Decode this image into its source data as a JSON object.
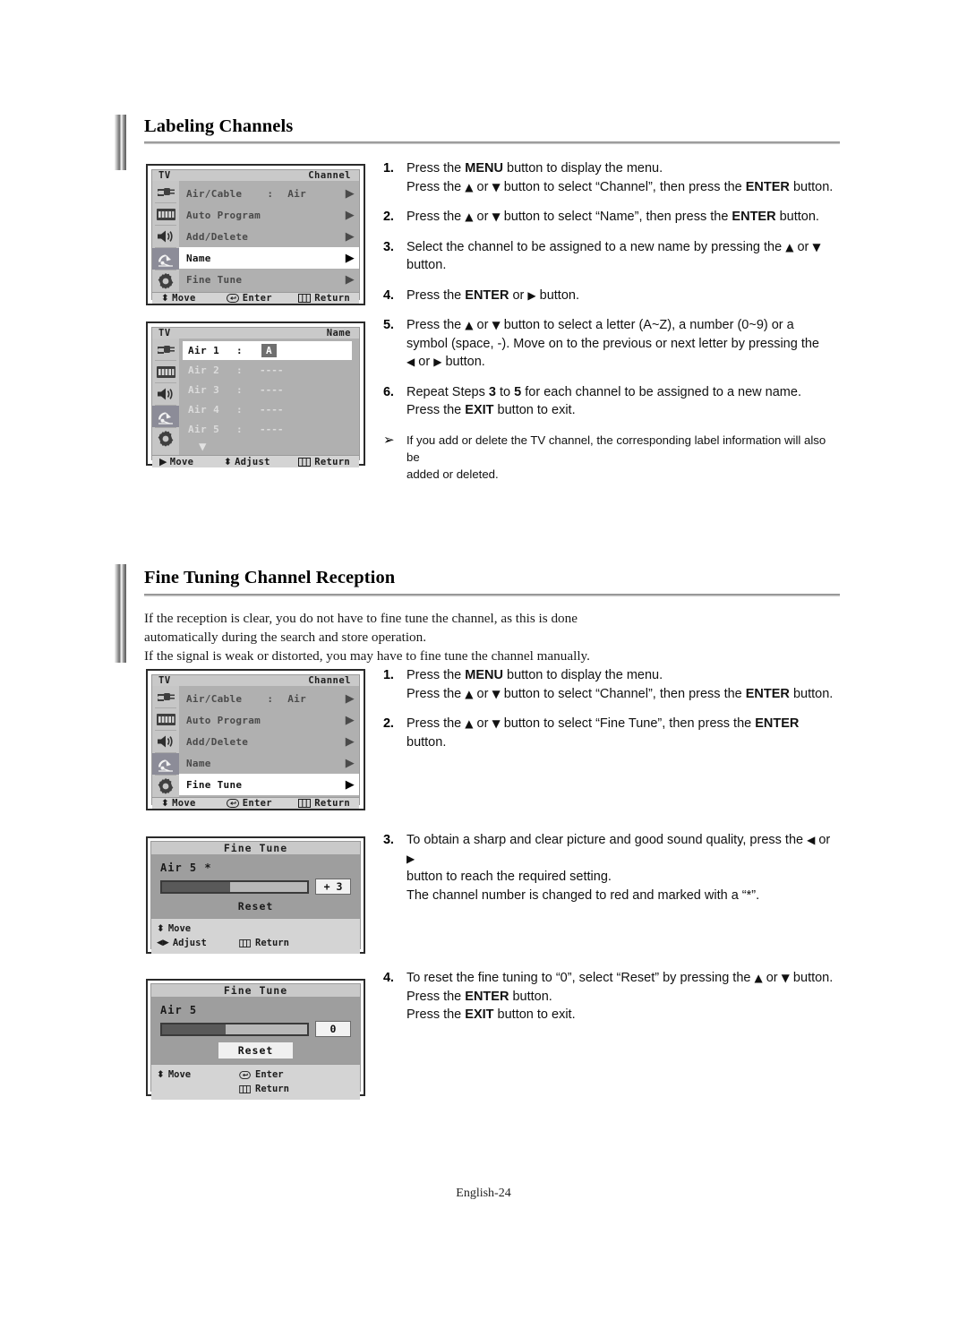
{
  "document": {
    "footer_page": "English-24"
  },
  "sections": [
    {
      "title": "Labeling Channels",
      "steps": [
        {
          "num": "1.",
          "lines": [
            {
              "parts": [
                {
                  "t": "Press the "
                },
                {
                  "t": "MENU",
                  "b": true
                },
                {
                  "t": " button to display the menu."
                }
              ]
            },
            {
              "parts": [
                {
                  "t": "Press the "
                },
                {
                  "t": "▲",
                  "icon": true
                },
                {
                  "t": " or "
                },
                {
                  "t": "▼",
                  "icon": true
                },
                {
                  "t": " button to select “Channel”, then press the "
                },
                {
                  "t": "ENTER",
                  "b": true
                },
                {
                  "t": " button."
                }
              ]
            }
          ]
        },
        {
          "num": "2.",
          "lines": [
            {
              "parts": [
                {
                  "t": "Press the "
                },
                {
                  "t": "▲",
                  "icon": true
                },
                {
                  "t": " or "
                },
                {
                  "t": "▼",
                  "icon": true
                },
                {
                  "t": " button to select “Name”, then press the "
                },
                {
                  "t": "ENTER",
                  "b": true
                },
                {
                  "t": " button."
                }
              ]
            }
          ]
        },
        {
          "num": "3.",
          "lines": [
            {
              "parts": [
                {
                  "t": "Select the channel to be assigned to a new name by pressing the "
                },
                {
                  "t": "▲",
                  "icon": true
                },
                {
                  "t": " or "
                },
                {
                  "t": "▼",
                  "icon": true
                }
              ]
            },
            {
              "parts": [
                {
                  "t": "button."
                }
              ]
            }
          ]
        },
        {
          "num": "4.",
          "lines": [
            {
              "parts": [
                {
                  "t": "Press the "
                },
                {
                  "t": "ENTER",
                  "b": true
                },
                {
                  "t": " or "
                },
                {
                  "t": "▶",
                  "icon": true
                },
                {
                  "t": " button."
                }
              ]
            }
          ]
        },
        {
          "num": "5.",
          "lines": [
            {
              "parts": [
                {
                  "t": "Press the "
                },
                {
                  "t": "▲",
                  "icon": true
                },
                {
                  "t": " or "
                },
                {
                  "t": "▼",
                  "icon": true
                },
                {
                  "t": " button to select a letter (A~Z), a number (0~9) or a"
                }
              ]
            },
            {
              "parts": [
                {
                  "t": "symbol (space, -). Move on to the previous or next letter by pressing the"
                }
              ]
            },
            {
              "parts": [
                {
                  "t": "◀",
                  "icon": true
                },
                {
                  "t": " or "
                },
                {
                  "t": "▶",
                  "icon": true
                },
                {
                  "t": " button."
                }
              ]
            }
          ]
        },
        {
          "num": "6.",
          "lines": [
            {
              "parts": [
                {
                  "t": "Repeat Steps "
                },
                {
                  "t": "3",
                  "b": true
                },
                {
                  "t": " to "
                },
                {
                  "t": "5",
                  "b": true
                },
                {
                  "t": " for each channel to be assigned to a new name."
                }
              ]
            },
            {
              "parts": [
                {
                  "t": "Press the "
                },
                {
                  "t": "EXIT",
                  "b": true
                },
                {
                  "t": " button to exit."
                }
              ]
            }
          ]
        }
      ],
      "note": {
        "mark": "➢",
        "lines": [
          "If you add or delete the TV channel, the corresponding label information will also be",
          "added or deleted."
        ]
      }
    },
    {
      "title": "Fine Tuning Channel Reception",
      "intro": [
        "If the reception is clear, you do not have to fine tune the channel, as this is done",
        "automatically during the search and store operation.",
        "If the signal is weak or distorted, you may have to fine tune the channel manually."
      ],
      "steps_top": [
        {
          "num": "1.",
          "lines": [
            {
              "parts": [
                {
                  "t": "Press the "
                },
                {
                  "t": "MENU",
                  "b": true
                },
                {
                  "t": " button to display the menu."
                }
              ]
            },
            {
              "parts": [
                {
                  "t": "Press the "
                },
                {
                  "t": "▲",
                  "icon": true
                },
                {
                  "t": " or "
                },
                {
                  "t": "▼",
                  "icon": true
                },
                {
                  "t": " button to select “Channel”, then press the "
                },
                {
                  "t": "ENTER",
                  "b": true
                },
                {
                  "t": " button."
                }
              ]
            }
          ]
        },
        {
          "num": "2.",
          "lines": [
            {
              "parts": [
                {
                  "t": "Press the "
                },
                {
                  "t": "▲",
                  "icon": true
                },
                {
                  "t": " or "
                },
                {
                  "t": "▼",
                  "icon": true
                },
                {
                  "t": " button to select “Fine Tune”, then press the "
                },
                {
                  "t": "ENTER",
                  "b": true
                }
              ]
            },
            {
              "parts": [
                {
                  "t": "button."
                }
              ]
            }
          ]
        }
      ],
      "steps_mid": [
        {
          "num": "3.",
          "lines": [
            {
              "parts": [
                {
                  "t": "To obtain a sharp and clear picture and good sound quality, press the "
                },
                {
                  "t": "◀",
                  "icon": true
                },
                {
                  "t": " or "
                },
                {
                  "t": "▶",
                  "icon": true
                }
              ]
            },
            {
              "parts": [
                {
                  "t": "button to reach the required setting."
                }
              ]
            },
            {
              "parts": [
                {
                  "t": "The channel number is changed to red and marked with a “*”."
                }
              ]
            }
          ]
        }
      ],
      "steps_bottom": [
        {
          "num": "4.",
          "lines": [
            {
              "parts": [
                {
                  "t": "To reset the fine tuning to “0”, select “Reset” by pressing the "
                },
                {
                  "t": "▲",
                  "icon": true
                },
                {
                  "t": " or "
                },
                {
                  "t": "▼",
                  "icon": true
                },
                {
                  "t": " button."
                }
              ]
            },
            {
              "parts": [
                {
                  "t": "Press the "
                },
                {
                  "t": "ENTER",
                  "b": true
                },
                {
                  "t": " button."
                }
              ]
            },
            {
              "parts": [
                {
                  "t": "Press the "
                },
                {
                  "t": "EXIT",
                  "b": true
                },
                {
                  "t": " button to exit."
                }
              ]
            }
          ]
        }
      ]
    }
  ],
  "osd_channel_name": {
    "device_label": "TV",
    "menu_title": "Channel",
    "rail_icons": [
      "input-icon",
      "picture-icon",
      "sound-icon",
      "channel-dish-icon",
      "setup-gear-icon"
    ],
    "selected_rail_index": 3,
    "rows": [
      {
        "label": "Air/Cable",
        "colon": ":",
        "value": "Air",
        "arrow": "▶",
        "highlighted": false
      },
      {
        "label": "Auto Program",
        "colon": "",
        "value": "",
        "arrow": "▶",
        "highlighted": false
      },
      {
        "label": "Add/Delete",
        "colon": "",
        "value": "",
        "arrow": "▶",
        "highlighted": false
      },
      {
        "label": "Name",
        "colon": "",
        "value": "",
        "arrow": "▶",
        "highlighted": true
      },
      {
        "label": "Fine Tune",
        "colon": "",
        "value": "",
        "arrow": "▶",
        "highlighted": false
      }
    ],
    "footer": [
      {
        "icon": "updown-icon",
        "label": "Move"
      },
      {
        "icon": "enter-icon",
        "label": "Enter"
      },
      {
        "icon": "return-icon",
        "label": "Return"
      }
    ]
  },
  "osd_name": {
    "device_label": "TV",
    "menu_title": "Name",
    "rail_icons": [
      "input-icon",
      "picture-icon",
      "sound-icon",
      "channel-dish-icon",
      "setup-gear-icon"
    ],
    "selected_rail_index": 3,
    "rows": [
      {
        "channel": "Air 1",
        "colon": ":",
        "chars": "A",
        "editing": true
      },
      {
        "channel": "Air 2",
        "colon": ":",
        "chars": "----",
        "editing": false
      },
      {
        "channel": "Air 3",
        "colon": ":",
        "chars": "----",
        "editing": false
      },
      {
        "channel": "Air 4",
        "colon": ":",
        "chars": "----",
        "editing": false
      },
      {
        "channel": "Air 5",
        "colon": ":",
        "chars": "----",
        "editing": false
      }
    ],
    "scroll_down_icon": "▼",
    "footer": [
      {
        "icon": "right-icon",
        "label": "Move"
      },
      {
        "icon": "updown-icon",
        "label": "Adjust"
      },
      {
        "icon": "return-icon",
        "label": "Return"
      }
    ]
  },
  "osd_channel_finetune": {
    "device_label": "TV",
    "menu_title": "Channel",
    "rail_icons": [
      "input-icon",
      "picture-icon",
      "sound-icon",
      "channel-dish-icon",
      "setup-gear-icon"
    ],
    "selected_rail_index": 3,
    "rows": [
      {
        "label": "Air/Cable",
        "colon": ":",
        "value": "Air",
        "arrow": "▶",
        "highlighted": false
      },
      {
        "label": "Auto Program",
        "colon": "",
        "value": "",
        "arrow": "▶",
        "highlighted": false
      },
      {
        "label": "Add/Delete",
        "colon": "",
        "value": "",
        "arrow": "▶",
        "highlighted": false
      },
      {
        "label": "Name",
        "colon": "",
        "value": "",
        "arrow": "▶",
        "highlighted": false
      },
      {
        "label": "Fine Tune",
        "colon": "",
        "value": "",
        "arrow": "▶",
        "highlighted": true
      }
    ],
    "footer": [
      {
        "icon": "updown-icon",
        "label": "Move"
      },
      {
        "icon": "enter-icon",
        "label": "Enter"
      },
      {
        "icon": "return-icon",
        "label": "Return"
      }
    ]
  },
  "finetune_adjust": {
    "title": "Fine Tune",
    "channel": "Air 5 *",
    "value": "+ 3",
    "fill_percent": 47,
    "reset_label": "Reset",
    "reset_boxed": false,
    "footer": [
      {
        "icon": "updown-icon",
        "label": "Move"
      },
      {
        "icon": "leftright-icon",
        "label": "Adjust"
      },
      {
        "icon": "return-icon",
        "label": "Return"
      }
    ]
  },
  "finetune_reset": {
    "title": "Fine Tune",
    "channel": "Air 5",
    "value": "0",
    "fill_percent": 44,
    "reset_label": "Reset",
    "reset_boxed": true,
    "footer": [
      {
        "icon": "updown-icon",
        "label": "Move"
      },
      {
        "icon": "enter-icon",
        "label": "Enter"
      },
      {
        "icon": "return-icon",
        "label": "Return"
      }
    ]
  }
}
